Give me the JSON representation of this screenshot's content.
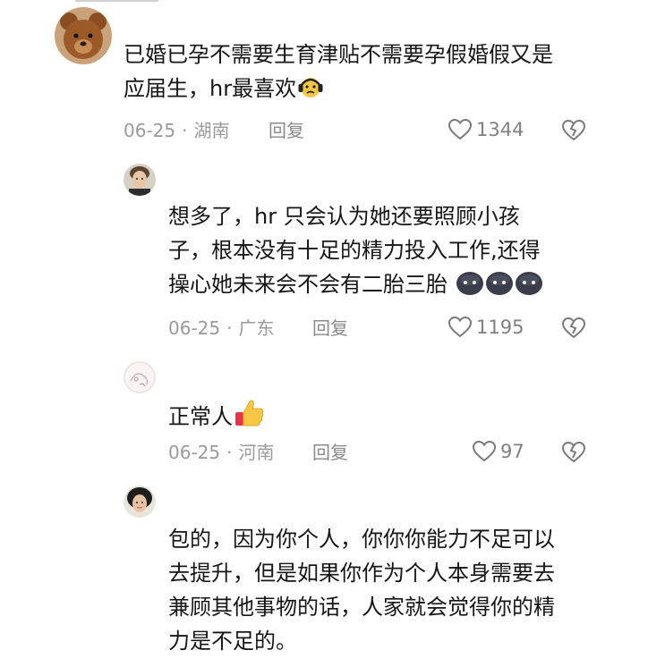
{
  "comments": [
    {
      "text_lines": [
        "已婚已孕不需要生育津贴不需要孕假婚假又是",
        "应届生，hr最喜欢"
      ],
      "emoji": "headphones-sweat-emoji",
      "date": "06-25",
      "location": "湖南",
      "reply_label": "回复",
      "likes": "1344"
    },
    {
      "text_lines": [
        "想多了，hr 只会认为她还要照顾小孩",
        "子，根本没有十足的精力投入工作,还得",
        "操心她未来会不会有二胎三胎"
      ],
      "emoji": "dark-ball-emoji",
      "date": "06-25",
      "location": "广东",
      "reply_label": "回复",
      "likes": "1195"
    },
    {
      "text_lines": [
        "正常人"
      ],
      "emoji": "thumbs-up-emoji",
      "date": "06-25",
      "location": "河南",
      "reply_label": "回复",
      "likes": "97"
    },
    {
      "text_lines": [
        "包的，因为你个人，你你你能力不足可以",
        "去提升，但是如果你作为个人本身需要去",
        "兼顾其他事物的话，人家就会觉得你的精",
        "力是不足的。"
      ]
    }
  ],
  "colors": {
    "text": "#161616",
    "meta": "#9a9a9a",
    "icon": "#7a7a7a"
  }
}
